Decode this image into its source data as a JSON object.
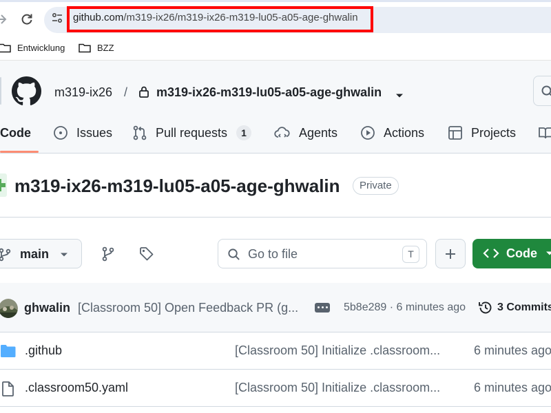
{
  "browser": {
    "url_domain": "github.com",
    "url_path": "/m319-ix26/m319-ix26-m319-lu05-a05-age-ghwalin",
    "bookmarks": [
      "Entwicklung",
      "BZZ"
    ]
  },
  "repo_header": {
    "owner": "m319-ix26",
    "separator": "/",
    "repo_name": "m319-ix26-m319-lu05-a05-age-ghwalin"
  },
  "tabs": {
    "code": "Code",
    "issues": "Issues",
    "pull_requests": "Pull requests",
    "pull_requests_count": "1",
    "agents": "Agents",
    "actions": "Actions",
    "projects": "Projects"
  },
  "title": {
    "name": "m319-ix26-m319-lu05-a05-age-ghwalin",
    "visibility": "Private"
  },
  "toolbar": {
    "branch": "main",
    "goto_placeholder": "Go to file",
    "goto_shortcut": "T",
    "code_button": "Code"
  },
  "latest_commit": {
    "author": "ghwalin",
    "message": "[Classroom 50] Open Feedback PR (g...",
    "hash_time": "5b8e289 · 6 minutes ago",
    "commits_label": "3 Commits"
  },
  "files": [
    {
      "name": ".github",
      "type": "folder",
      "message": "[Classroom 50] Initialize .classroom...",
      "age": "6 minutes ago"
    },
    {
      "name": ".classroom50.yaml",
      "type": "file",
      "message": "[Classroom 50] Initialize .classroom...",
      "age": "6 minutes ago"
    }
  ],
  "colors": {
    "url_highlight": "#ff0000",
    "code_button": "#1f883d",
    "active_tab_underline": "#fd8c73",
    "folder_icon": "#54aeff"
  }
}
